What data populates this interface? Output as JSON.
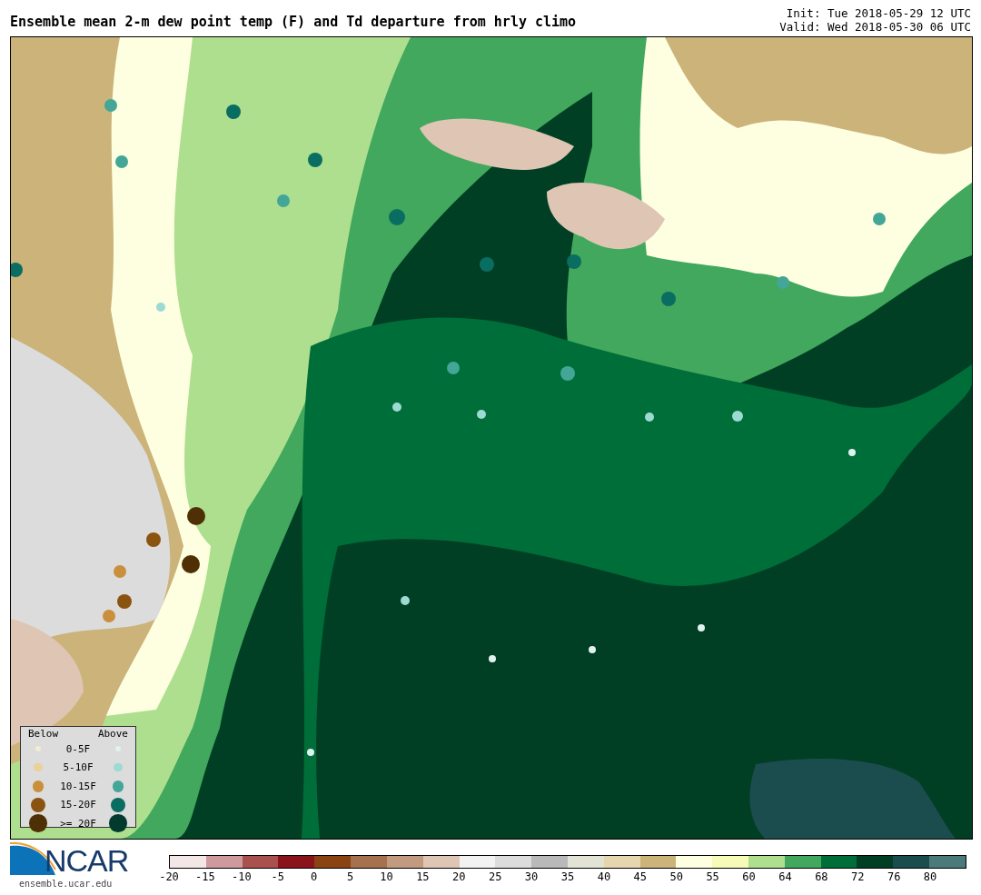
{
  "title": "Ensemble mean 2-m dew point temp (F) and Td departure from hrly climo",
  "init": "Init: Tue 2018-05-29 12 UTC",
  "valid": "Valid: Wed 2018-05-30 06 UTC",
  "legend": {
    "below_heading": "Below",
    "above_heading": "Above",
    "rows": [
      {
        "label": "0-5F",
        "below": {
          "color": "#f4ecd2"
        },
        "above": {
          "color": "#e0f2f0"
        }
      },
      {
        "label": "5-10F",
        "below": {
          "color": "#ead19a"
        },
        "above": {
          "color": "#9cdad2"
        }
      },
      {
        "label": "10-15F",
        "below": {
          "color": "#c98f3c"
        },
        "above": {
          "color": "#43a697"
        }
      },
      {
        "label": "15-20F",
        "below": {
          "color": "#8b5310"
        },
        "above": {
          "color": "#0a6d62"
        }
      },
      {
        "label": ">= 20F",
        "below": {
          "color": "#4f2f05"
        },
        "above": {
          "color": "#033a2e"
        }
      }
    ]
  },
  "logo": {
    "text": "NCAR",
    "url": "ensemble.ucar.edu"
  },
  "colorbar": {
    "segments": [
      {
        "color": "#f3e6e6"
      },
      {
        "color": "#cf9a9d"
      },
      {
        "color": "#a8514f"
      },
      {
        "color": "#8b141c"
      },
      {
        "color": "#8a4312"
      },
      {
        "color": "#a5714f"
      },
      {
        "color": "#c29a80"
      },
      {
        "color": "#dfc5b3"
      },
      {
        "color": "#f2f2f2"
      },
      {
        "color": "#dcdcdc"
      },
      {
        "color": "#b9b9b9"
      },
      {
        "color": "#e3e3d5"
      },
      {
        "color": "#e6d6ad"
      },
      {
        "color": "#cbb37a"
      },
      {
        "color": "#feffe0"
      },
      {
        "color": "#f7fbb8"
      },
      {
        "color": "#addf8e"
      },
      {
        "color": "#41a85d"
      },
      {
        "color": "#006e38"
      },
      {
        "color": "#003f24"
      },
      {
        "color": "#1b4d4f"
      },
      {
        "color": "#4a7a7a"
      }
    ],
    "ticks": [
      "-20",
      "-15",
      "-10",
      "-5",
      "0",
      "5",
      "10",
      "15",
      "20",
      "25",
      "30",
      "35",
      "40",
      "45",
      "50",
      "55",
      "60",
      "64",
      "68",
      "72",
      "76",
      "80"
    ]
  }
}
